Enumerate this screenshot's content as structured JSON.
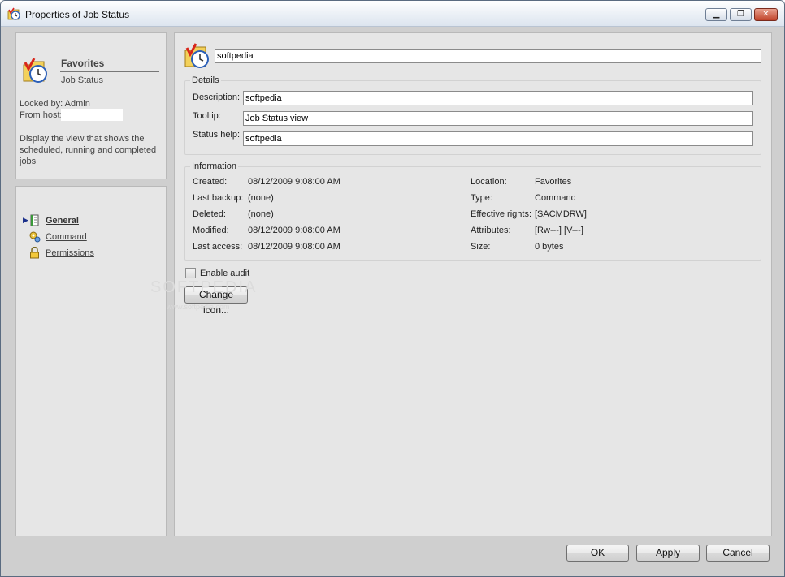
{
  "window": {
    "title": "Properties of Job Status",
    "controls": {
      "minimize": "▁",
      "maximize": "❐",
      "close": "✕"
    }
  },
  "head_panel": {
    "folder": "Favorites",
    "item": "Job Status",
    "locked_by": "Locked by: Admin",
    "from_host_label": "From host:",
    "from_host_value": "",
    "description": "Display the view that shows the scheduled, running and completed jobs"
  },
  "nav": {
    "items": [
      {
        "label": "General",
        "icon": "general-page-icon",
        "active": true
      },
      {
        "label": "Command",
        "icon": "command-gear-icon",
        "active": false
      },
      {
        "label": "Permissions",
        "icon": "padlock-icon",
        "active": false
      }
    ]
  },
  "main": {
    "name_value": "softpedia",
    "details": {
      "legend": "Details",
      "description_label": "Description:",
      "description_value": "softpedia",
      "tooltip_label": "Tooltip:",
      "tooltip_value": "Job Status view",
      "status_help_label": "Status help:",
      "status_help_value": "softpedia"
    },
    "information": {
      "legend": "Information",
      "left": [
        {
          "label": "Created:",
          "value": "08/12/2009 9:08:00 AM"
        },
        {
          "label": "Last backup:",
          "value": "(none)"
        },
        {
          "label": "Deleted:",
          "value": "(none)"
        },
        {
          "label": "Modified:",
          "value": "08/12/2009 9:08:00 AM"
        },
        {
          "label": "Last access:",
          "value": "08/12/2009 9:08:00 AM"
        }
      ],
      "right": [
        {
          "label": "Location:",
          "value": "Favorites"
        },
        {
          "label": "Type:",
          "value": "Command"
        },
        {
          "label": "Effective rights:",
          "value": "[SACMDRW]"
        },
        {
          "label": "Attributes:",
          "value": "[Rw---] [V---]"
        },
        {
          "label": "Size:",
          "value": "0 bytes"
        }
      ]
    },
    "enable_audit_label": "Enable audit",
    "enable_audit_checked": false,
    "change_icon_label": "Change icon..."
  },
  "footer": {
    "ok": "OK",
    "apply": "Apply",
    "cancel": "Cancel"
  },
  "watermark": {
    "brand": "SOFTPEDIA",
    "url": "www.softpedia.com"
  },
  "colors": {
    "panel": "#e6e6e6",
    "frame": "#cfcfcf",
    "accent": "#1a2f8a"
  }
}
